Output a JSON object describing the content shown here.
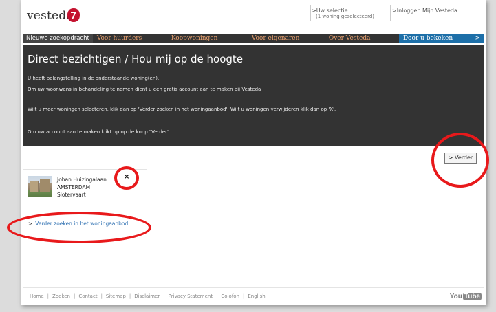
{
  "header": {
    "logo_text": "vesteda",
    "selection_link": ">Uw selectie",
    "selection_sub": "(1 woning geselecteerd)",
    "login_link": ">Inloggen Mijn Vesteda"
  },
  "nav": {
    "items": [
      "Nieuwe zoekopdracht",
      "Voor huurders",
      "Koopwoningen",
      "Voor eigenaren",
      "Over Vesteda",
      "Door u bekeken"
    ],
    "more_glyph": ">"
  },
  "panel": {
    "title": "Direct bezichtigen / Hou mij op de hoogte",
    "line1": "U heeft belangstelling in de onderstaande woning(en).",
    "line2": "Om uw woonwens in behandeling te nemen dient u een gratis account aan te maken bij Vesteda",
    "line3": "Wilt u meer woningen selecteren, klik dan op 'Verder zoeken in het woningaanbod'. Wilt u woningen verwijderen klik dan op 'X'.",
    "line4": "Om uw account aan te maken klikt up op de knop \"Verder\""
  },
  "verder_button": "> Verder",
  "property": {
    "street": "Johan Huizingalaan",
    "city": "AMSTERDAM",
    "district": "Slotervaart",
    "remove_label": "×"
  },
  "more_link": {
    "arrow": ">",
    "text": "Verder zoeken in het woningaanbod"
  },
  "footer": {
    "links": [
      "Home",
      "Zoeken",
      "Contact",
      "Sitemap",
      "Disclaimer",
      "Privacy Statement",
      "Colofon",
      "English"
    ],
    "separator": "|",
    "youtube_you": "You",
    "youtube_tube": "Tube"
  },
  "colors": {
    "accent_red": "#e8191b",
    "nav_bg": "#333333",
    "nav_text": "#e8a06e",
    "nav_highlight": "#1d6fa8",
    "link_blue": "#2a6db0"
  }
}
